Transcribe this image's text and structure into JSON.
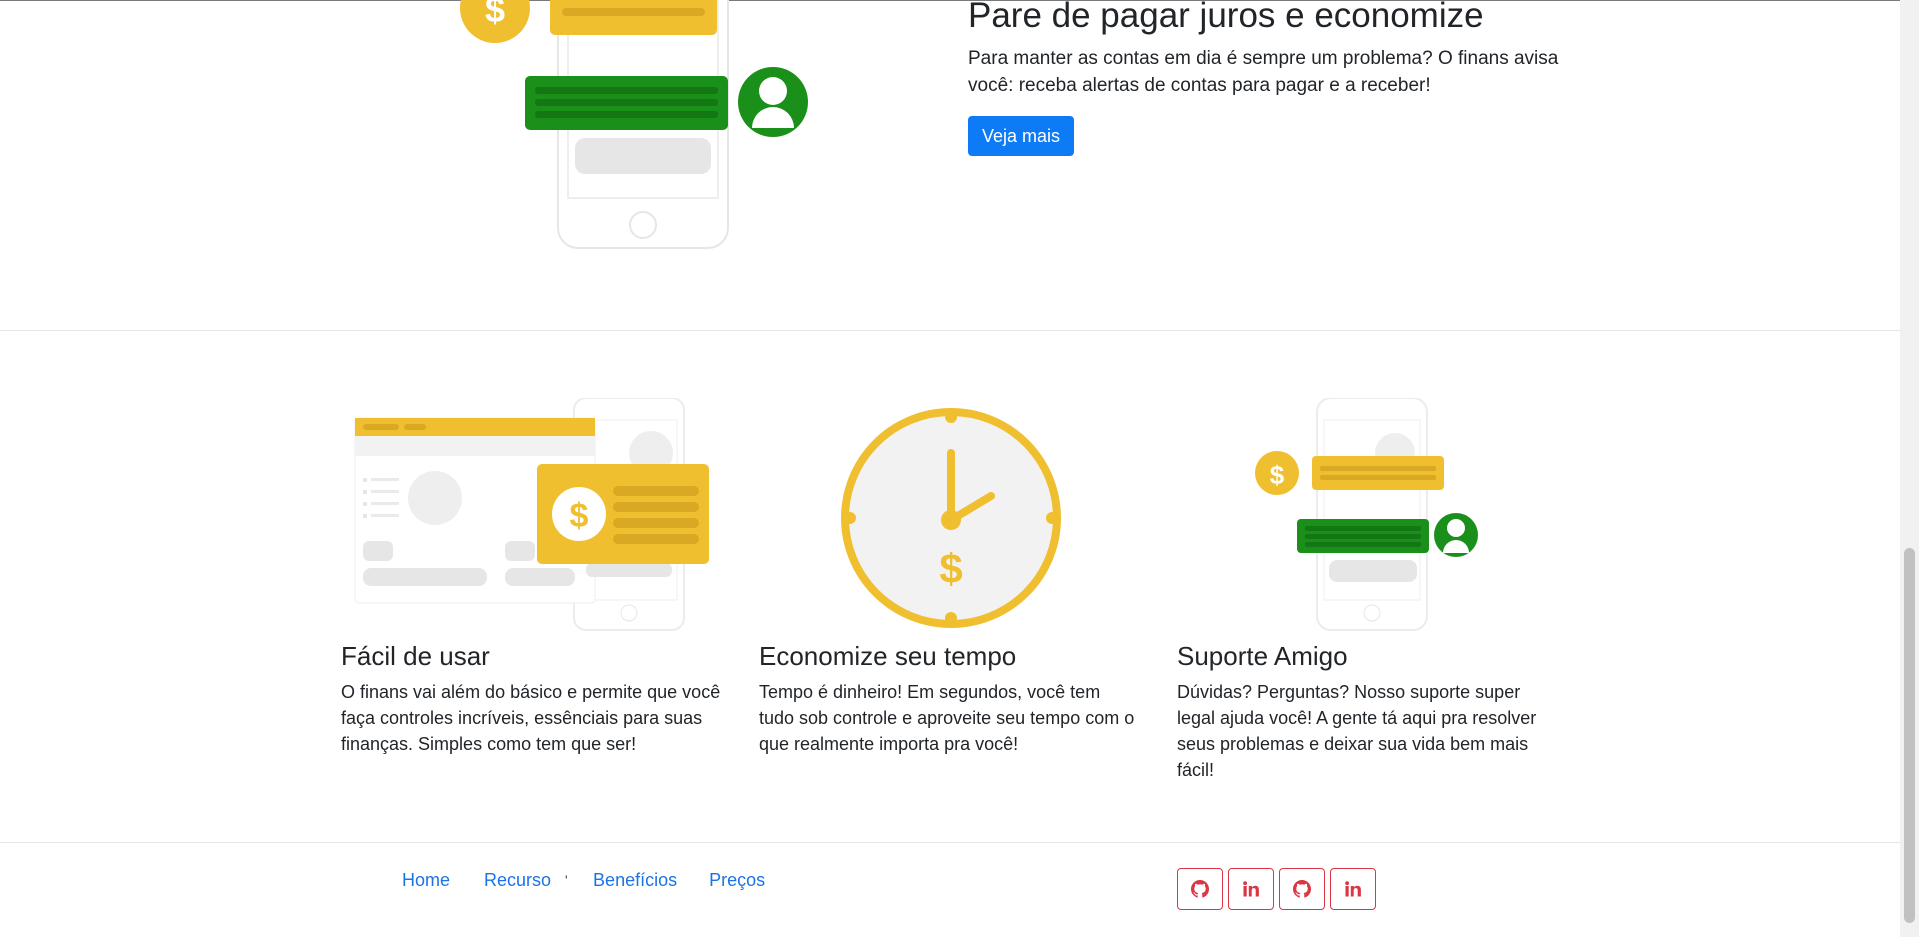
{
  "hero": {
    "title": "Pare de pagar juros e economize",
    "text": "Para manter as contas em dia é sempre um problema? O finans avisa você: receba alertas de contas para pagar e a receber!",
    "button_label": "Veja mais"
  },
  "features": [
    {
      "title": "Fácil de usar",
      "text": "O finans vai além do básico e permite que você faça controles incríveis, essênciais para suas finanças. Simples como tem que ser!"
    },
    {
      "title": "Economize seu tempo",
      "text": "Tempo é dinheiro! Em segundos, você tem tudo sob controle e aproveite seu tempo com o que realmente importa pra você!"
    },
    {
      "title": "Suporte Amigo",
      "text": "Dúvidas? Perguntas? Nosso suporte super legal ajuda você! A gente tá aqui pra resolver seus problemas e deixar sua vida bem mais fácil!"
    }
  ],
  "footer": {
    "links": [
      "Home",
      "Recurso",
      "Benefícios",
      "Preços"
    ],
    "tick": "'",
    "social": [
      "github-icon",
      "linkedin-icon",
      "github-icon",
      "linkedin-icon"
    ]
  },
  "colors": {
    "primary": "#0d7bf5",
    "yellow": "#f0bf30",
    "green": "#1a8f1a",
    "danger": "#dc3545"
  }
}
